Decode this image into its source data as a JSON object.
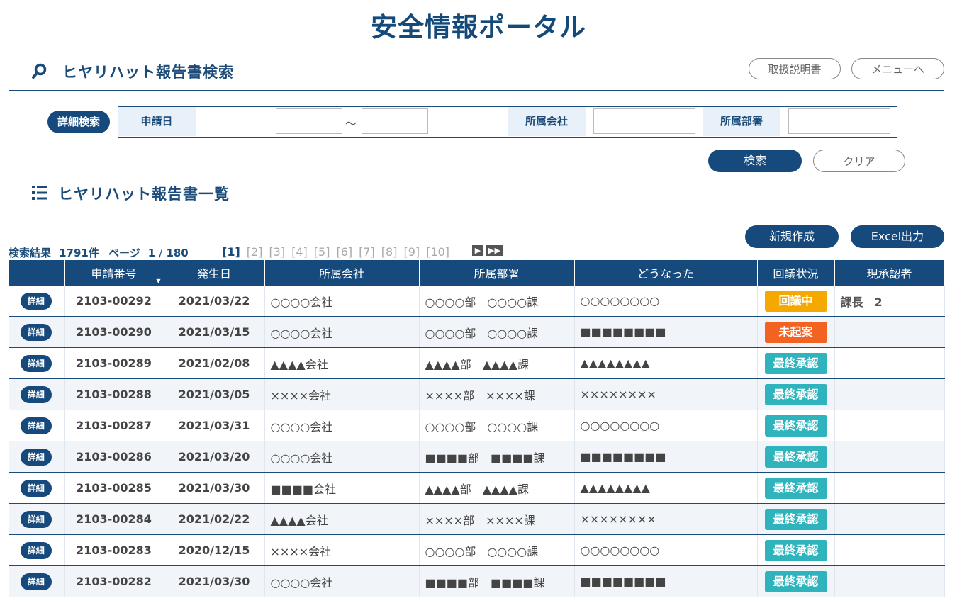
{
  "page_title": "安全情報ポータル",
  "search_section": {
    "title": "ヒヤリハット報告書検索"
  },
  "header_buttons": {
    "manual": "取扱説明書",
    "menu": "メニューへ"
  },
  "filters": {
    "detail_label": "詳細検索",
    "date_label": "申請日",
    "tilde": "～",
    "company_label": "所属会社",
    "dept_label": "所属部署",
    "date_from": "",
    "date_to": "",
    "company": "",
    "dept": ""
  },
  "filter_buttons": {
    "search": "検索",
    "clear": "クリア"
  },
  "list_section": {
    "title": "ヒヤリハット報告書一覧"
  },
  "list_buttons": {
    "new": "新規作成",
    "excel": "Excel出力"
  },
  "result_meta": {
    "label": "検索結果",
    "count": "1791件",
    "page_label": "ページ",
    "page_cur": "1",
    "page_sep": "/",
    "page_total": "180"
  },
  "pagination": {
    "pages": [
      "[1]",
      "[2]",
      "[3]",
      "[4]",
      "[5]",
      "[6]",
      "[7]",
      "[8]",
      "[9]",
      "[10]"
    ],
    "next": "▶",
    "last": "▶▶"
  },
  "table": {
    "headers": [
      "",
      "申請番号",
      "発生日",
      "所属会社",
      "所属部署",
      "どうなった",
      "回議状況",
      "現承認者"
    ],
    "detail_label": "詳細",
    "status_colors": {
      "回議中": "#f5a800",
      "未起案": "#f26322",
      "最終承認": "#2fb4be"
    },
    "rows": [
      {
        "no": "2103-00292",
        "date": "2021/03/22",
        "company": "○○○○会社",
        "dept": "○○○○部　○○○○課",
        "result": "○○○○○○○○",
        "status": "回議中",
        "approver": "課長　2"
      },
      {
        "no": "2103-00290",
        "date": "2021/03/15",
        "company": "○○○○会社",
        "dept": "○○○○部　○○○○課",
        "result": "■■■■■■■■",
        "status": "未起案",
        "approver": ""
      },
      {
        "no": "2103-00289",
        "date": "2021/02/08",
        "company": "▲▲▲▲会社",
        "dept": "▲▲▲▲部　▲▲▲▲課",
        "result": "▲▲▲▲▲▲▲▲",
        "status": "最終承認",
        "approver": ""
      },
      {
        "no": "2103-00288",
        "date": "2021/03/05",
        "company": "××××会社",
        "dept": "××××部　××××課",
        "result": "××××××××",
        "status": "最終承認",
        "approver": ""
      },
      {
        "no": "2103-00287",
        "date": "2021/03/31",
        "company": "○○○○会社",
        "dept": "○○○○部　○○○○課",
        "result": "○○○○○○○○",
        "status": "最終承認",
        "approver": ""
      },
      {
        "no": "2103-00286",
        "date": "2021/03/20",
        "company": "○○○○会社",
        "dept": "■■■■部　■■■■課",
        "result": "■■■■■■■■",
        "status": "最終承認",
        "approver": ""
      },
      {
        "no": "2103-00285",
        "date": "2021/03/30",
        "company": "■■■■会社",
        "dept": "▲▲▲▲部　▲▲▲▲課",
        "result": "▲▲▲▲▲▲▲▲",
        "status": "最終承認",
        "approver": ""
      },
      {
        "no": "2103-00284",
        "date": "2021/02/22",
        "company": "▲▲▲▲会社",
        "dept": "××××部　××××課",
        "result": "××××××××",
        "status": "最終承認",
        "approver": ""
      },
      {
        "no": "2103-00283",
        "date": "2020/12/15",
        "company": "××××会社",
        "dept": "○○○○部　○○○○課",
        "result": "○○○○○○○○",
        "status": "最終承認",
        "approver": ""
      },
      {
        "no": "2103-00282",
        "date": "2021/03/30",
        "company": "○○○○会社",
        "dept": "■■■■部　■■■■課",
        "result": "■■■■■■■■",
        "status": "最終承認",
        "approver": ""
      }
    ]
  }
}
